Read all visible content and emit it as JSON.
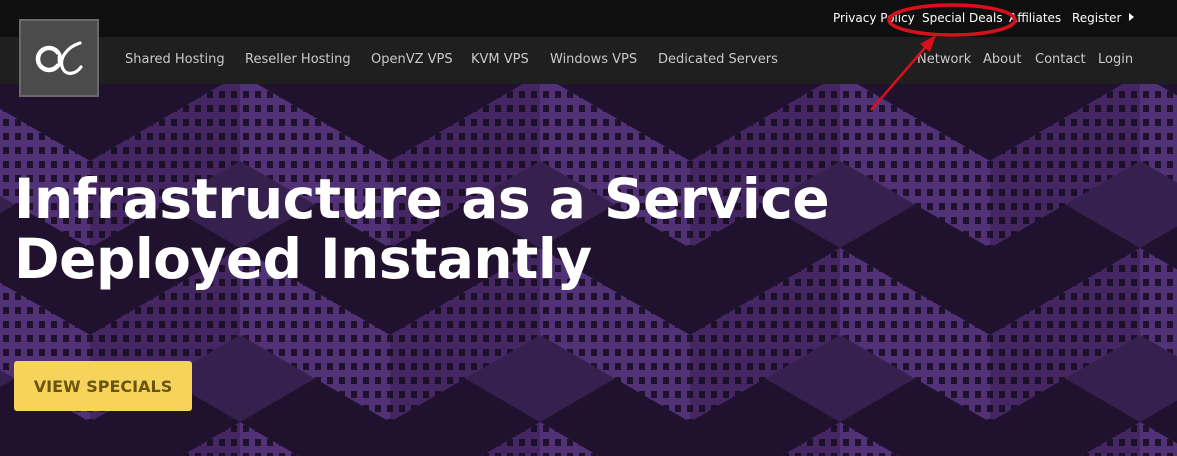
{
  "top_bar": {
    "links": [
      {
        "label": "Privacy Policy"
      },
      {
        "label": "Special Deals"
      },
      {
        "label": "Affiliates"
      },
      {
        "label": "Register"
      }
    ]
  },
  "logo": {
    "icon": "alpha-logo-icon"
  },
  "main_nav": {
    "left_items": [
      {
        "label": "Shared Hosting"
      },
      {
        "label": "Reseller Hosting"
      },
      {
        "label": "OpenVZ VPS"
      },
      {
        "label": "KVM VPS"
      },
      {
        "label": "Windows VPS"
      },
      {
        "label": "Dedicated Servers"
      }
    ],
    "right_items": [
      {
        "label": "Network"
      },
      {
        "label": "About"
      },
      {
        "label": "Contact"
      },
      {
        "label": "Login"
      }
    ]
  },
  "hero": {
    "title_line1": "Infrastructure as a Service",
    "title_line2": "Deployed Instantly",
    "cta_label": "VIEW SPECIALS"
  },
  "colors": {
    "topbar": "#0f0f0f",
    "navbar": "#1f1f1f",
    "hero_purple": "#5e3a86",
    "cta_yellow": "#f6d35b",
    "annotation_red": "#d8101c"
  }
}
